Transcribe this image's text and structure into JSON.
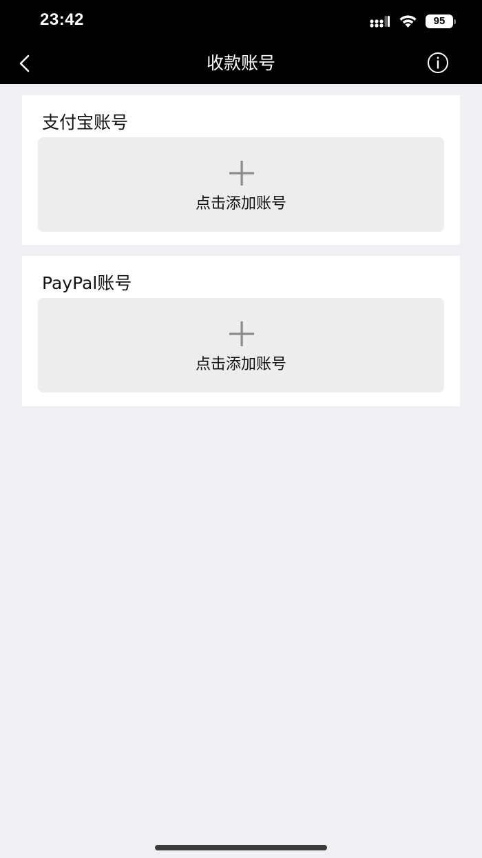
{
  "status_bar": {
    "time": "23:42",
    "battery": "95",
    "icons": [
      "signal-icon",
      "wifi-icon",
      "battery-icon"
    ]
  },
  "nav": {
    "title": "收款账号",
    "back_icon": "chevron-left-icon",
    "info_icon": "info-circle-icon"
  },
  "accounts": [
    {
      "title": "支付宝账号",
      "add_label": "点击添加账号",
      "icon": "plus-icon"
    },
    {
      "title": "PayPal账号",
      "add_label": "点击添加账号",
      "icon": "plus-icon"
    }
  ],
  "colors": {
    "nav_background": "#000000",
    "page_background": "#efeff4",
    "card_background": "#ffffff",
    "add_box_background": "#ededed",
    "plus_color": "#888888"
  }
}
